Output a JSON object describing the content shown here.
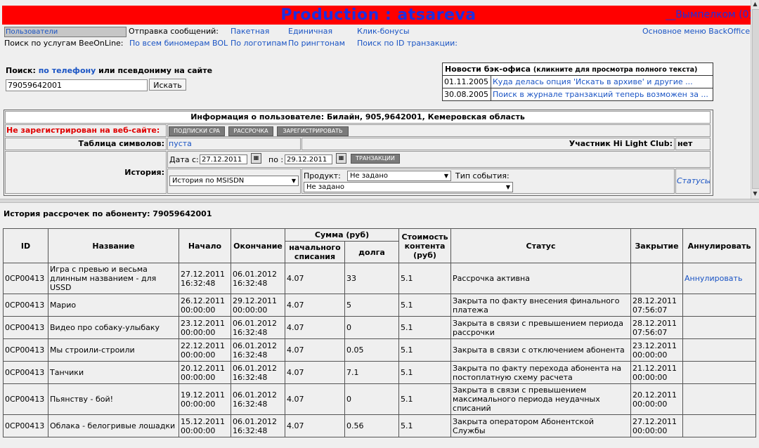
{
  "header": {
    "title": "Production : atsareva",
    "account": "__Вымпелком (0)"
  },
  "nav": {
    "users": "Пользователи",
    "send_label": "Отправка сообщений:",
    "batch": "Пакетная",
    "single": "Единичная",
    "click_bonus": "Клик-бонусы",
    "main_menu": "Основное меню BackOffice",
    "beeonline_label": "Поиск по услугам BeeOnLine:",
    "all_binomials": "По всем биномерам BOL",
    "by_logos": "По логотипам",
    "by_ringtones": "По рингтонам",
    "by_txid": "Поиск по ID транзакции:"
  },
  "search": {
    "label_prefix": "Поиск:",
    "by_phone": "по телефону",
    "label_suffix": "или псевдониму на сайте",
    "value": "79059642001",
    "button": "Искать"
  },
  "news": {
    "header": "Новости бэк-офиса",
    "header_hint": "(кликните для просмотра полного текста)",
    "items": [
      {
        "date": "01.11.2005",
        "text": "Куда делась опция 'Искать в архиве' и другие ..."
      },
      {
        "date": "30.08.2005",
        "text": "Поиск в журнале транзакций теперь возможен за ..."
      }
    ]
  },
  "user_info": {
    "title": "Информация о пользователе: Билайн, 905,9642001, Кемеровская область",
    "not_registered": "Не зарегистрирован на веб-сайте:",
    "btn_cpa": "подписки cpa",
    "btn_installment": "рассрочка",
    "btn_register": "зарегистрировать",
    "symbols_label": "Таблица символов:",
    "symbols_value": "пуста",
    "club_label": "Участник Hi Light Club:",
    "club_value": "нет",
    "history_label": "История:",
    "date_from_label": "Дата с:",
    "date_from": "27.12.2011",
    "date_to_label": "по :",
    "date_to": "29.12.2011",
    "btn_transactions": "транзакции",
    "history_select": "История по MSISDN",
    "product_label": "Продукт:",
    "product_value": "Не задано",
    "event_type_label": "Тип события:",
    "event_type_value": "Не задано",
    "statuses_link": "Статусы"
  },
  "history": {
    "title": "История рассрочек по абоненту: 79059642001",
    "headers": {
      "id": "ID",
      "name": "Название",
      "start": "Начало",
      "end": "Окончание",
      "sum": "Сумма (руб)",
      "initial": "начального списания",
      "debt": "долга",
      "cost": "Стоимость контента (руб)",
      "status": "Статус",
      "closed": "Закрытие",
      "cancel": "Аннулировать"
    },
    "rows": [
      {
        "id": "0CP00413",
        "name": "Игра с превью и весьма длинным названием - для USSD",
        "start": "27.12.2011 16:32:48",
        "end": "06.01.2012 16:32:48",
        "initial": "4.07",
        "debt": "33",
        "cost": "5.1",
        "status": "Рассрочка активна",
        "closed": "",
        "cancel": "Аннулировать"
      },
      {
        "id": "0CP00413",
        "name": "Марио",
        "start": "26.12.2011 00:00:00",
        "end": "29.12.2011 00:00:00",
        "initial": "4.07",
        "debt": "5",
        "cost": "5.1",
        "status": "Закрыта по факту внесения финального платежа",
        "closed": "28.12.2011 07:56:07",
        "cancel": ""
      },
      {
        "id": "0CP00413",
        "name": "Видео про собаку-улыбаку",
        "start": "23.12.2011 00:00:00",
        "end": "06.01.2012 16:32:48",
        "initial": "4.07",
        "debt": "0",
        "cost": "5.1",
        "status": "Закрыта в связи с превышением периода рассрочки",
        "closed": "28.12.2011 07:56:07",
        "cancel": ""
      },
      {
        "id": "0CP00413",
        "name": "Мы строили-строили",
        "start": "22.12.2011 00:00:00",
        "end": "06.01.2012 16:32:48",
        "initial": "4.07",
        "debt": "0.05",
        "cost": "5.1",
        "status": "Закрыта в связи с отключением абонента",
        "closed": "23.12.2011 00:00:00",
        "cancel": ""
      },
      {
        "id": "0CP00413",
        "name": "Танчики",
        "start": "20.12.2011 00:00:00",
        "end": "06.01.2012 16:32:48",
        "initial": "4.07",
        "debt": "7.1",
        "cost": "5.1",
        "status": "Закрыта по факту перехода абонента на постоплатную схему расчета",
        "closed": "21.12.2011 00:00:00",
        "cancel": ""
      },
      {
        "id": "0CP00413",
        "name": "Пьянству - бой!",
        "start": "19.12.2011 00:00:00",
        "end": "06.01.2012 16:32:48",
        "initial": "4.07",
        "debt": "0",
        "cost": "5.1",
        "status": "Закрыта в связи с превышением максимального периода неудачных списаний",
        "closed": "20.12.2011 00:00:00",
        "cancel": ""
      },
      {
        "id": "0CP00413",
        "name": "Облака - белогривые лошадки",
        "start": "15.12.2011 00:00:00",
        "end": "06.01.2012 16:32:48",
        "initial": "4.07",
        "debt": "0.56",
        "cost": "5.1",
        "status": "Закрыта оператором Абонентской Службы",
        "closed": "27.12.2011 00:00:00",
        "cancel": ""
      }
    ]
  }
}
